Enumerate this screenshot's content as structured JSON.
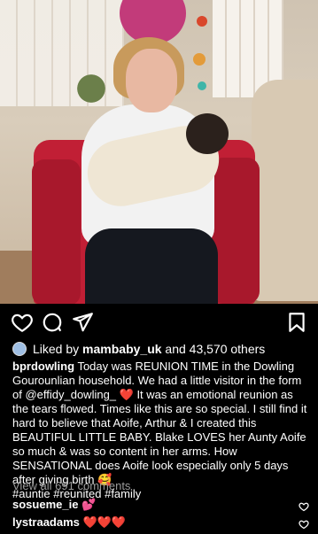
{
  "post": {
    "likes": {
      "prefix": "Liked by",
      "user": "mambaby_uk",
      "suffix": "and 43,570 others"
    },
    "caption": {
      "username": "bprdowling",
      "text": "Today was REUNION TIME in the Dowling Gourounlian household. We had a little visitor in the form of @effidy_dowling_ ❤️ It was an emotional reunion as the tears flowed. Times like this are so special. I still find it hard to believe that Aoife, Arthur & I created this BEAUTIFUL LITTLE BABY. Blake LOVES her Aunty Aoife so much & was so content in her arms. How SENSATIONAL does Aoife look especially only 5 days after giving birth 🥰",
      "hashtags": "#auntie #reunited #family"
    },
    "view_all_comments": "View all 691 comments",
    "comments": [
      {
        "username": "sosueme_ie",
        "text": "💕"
      },
      {
        "username": "lystraadams",
        "text": "❤️❤️❤️"
      }
    ]
  },
  "icons": {
    "like": "heart-icon",
    "comment": "comment-icon",
    "share": "paper-plane-icon",
    "save": "bookmark-icon"
  },
  "colors": {
    "background": "#000000",
    "text": "#ffffff",
    "muted": "#9a9a9a"
  }
}
